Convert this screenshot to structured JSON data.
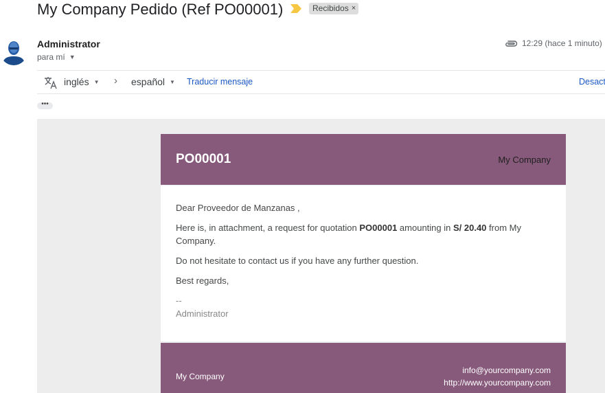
{
  "email": {
    "subject": "My Company Pedido (Ref PO00001)",
    "label": "Recibidos",
    "label_remove": "×",
    "sender": "Administrator",
    "to": "para mí",
    "time": "12:29 (hace 1 minuto)"
  },
  "translate": {
    "source_lang": "inglés",
    "target_lang": "español",
    "translate_link": "Traducir mensaje",
    "deactivate_link": "Desact"
  },
  "body": {
    "header_title": "PO00001",
    "header_company": "My Company",
    "greeting": "Dear Proveedor de Manzanas ,",
    "line1_pre": "Here is, in attachment, a request for quotation ",
    "line1_ref": "PO00001",
    "line1_mid": " amounting in ",
    "line1_amount": "S/ 20.40",
    "line1_post": " from My Company.",
    "line2": "Do not hesitate to contact us if you have any further question.",
    "regards": "Best regards,",
    "signature_sep": "--",
    "signature_name": "Administrator"
  },
  "footer": {
    "company": "My Company",
    "email": "info@yourcompany.com",
    "website": "http://www.yourcompany.com"
  },
  "colors": {
    "brand": "#875a7b",
    "link": "#1a57c4",
    "important_marker": "#f6c744"
  },
  "icons": [
    "important-marker-icon",
    "avatar",
    "attachment-icon",
    "translate-icon",
    "chevron-right-icon",
    "dropdown-caret-icon",
    "ellipsis-icon"
  ]
}
